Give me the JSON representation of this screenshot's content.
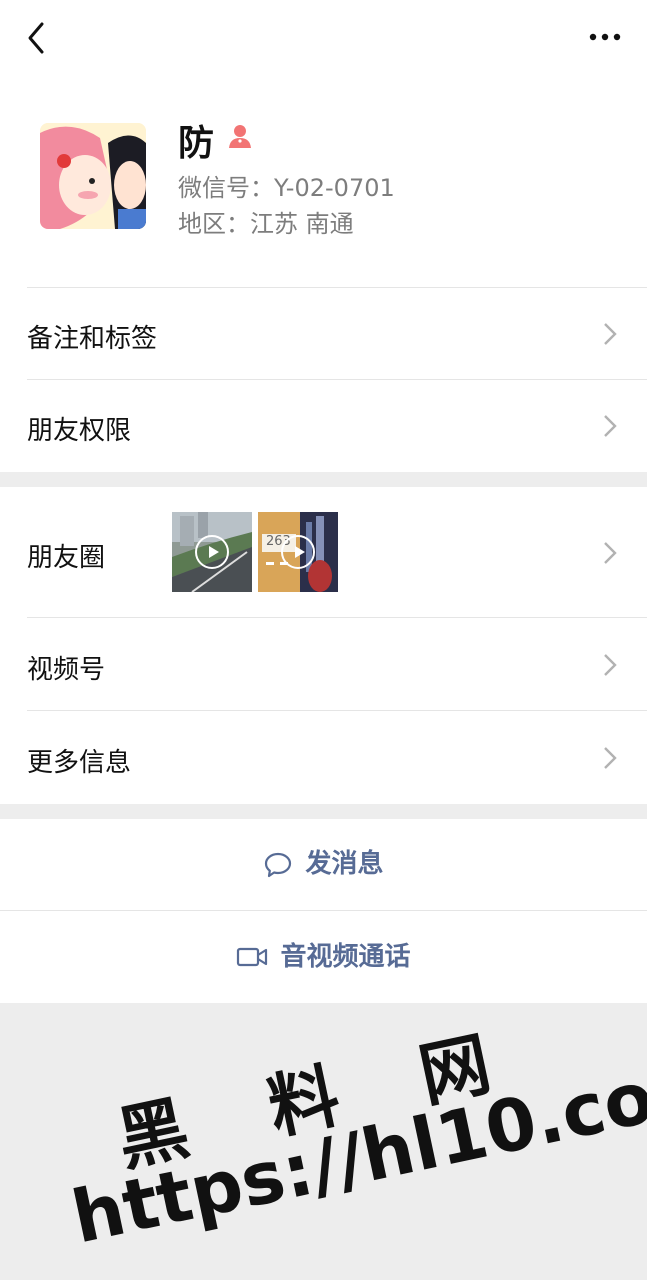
{
  "profile": {
    "name": "防",
    "wechat_id": "微信号：Y-02-0701",
    "region": "地区：江苏 南通"
  },
  "menu": {
    "remark_tags": "备注和标签",
    "friend_permissions": "朋友权限",
    "moments": "朋友圈",
    "moments_thumb2_text": "263",
    "channels": "视频号",
    "more_info": "更多信息"
  },
  "actions": {
    "send_message": "发消息",
    "video_call": "音视频通话"
  },
  "watermark": {
    "title": "黑 料 网",
    "url": "https://hl10.co"
  },
  "colors": {
    "link": "#576b95",
    "gender": "#f27474",
    "background": "#ededed"
  }
}
